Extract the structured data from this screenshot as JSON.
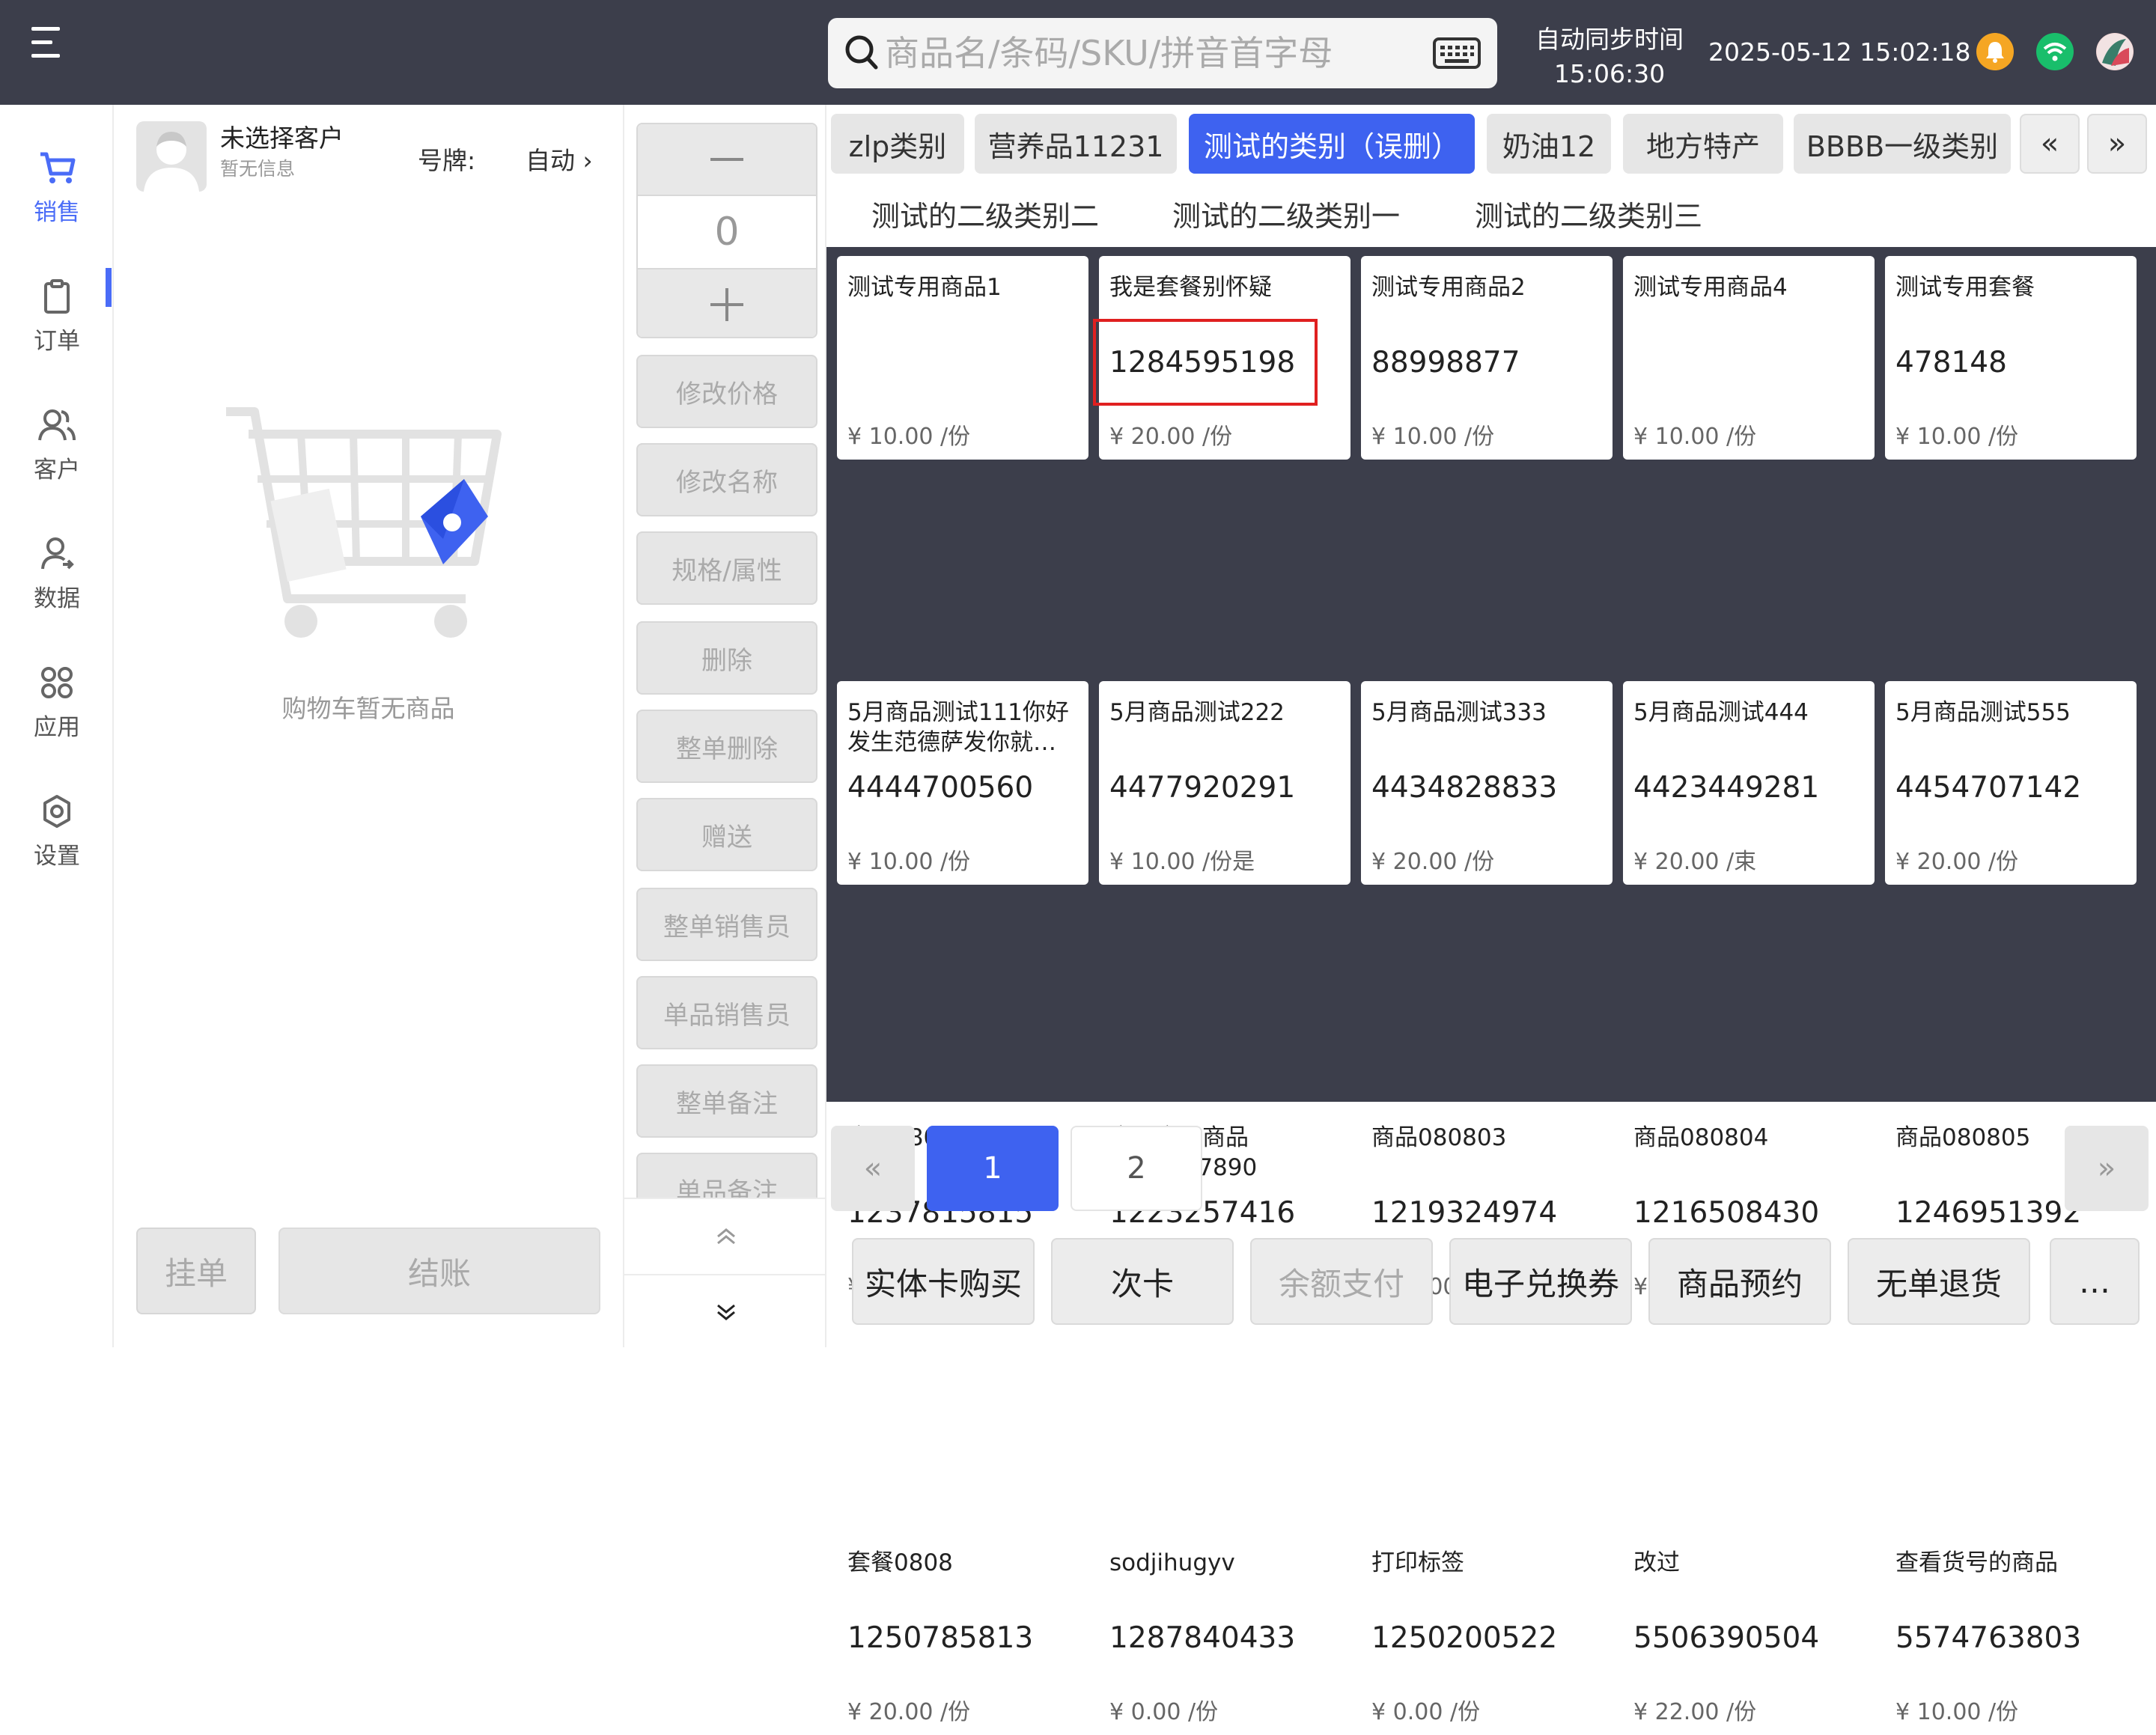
{
  "topbar": {
    "search_placeholder": "商品名/条码/SKU/拼音首字母",
    "sync_label": "自动同步时间",
    "sync_time": "15:06:30",
    "clock": "2025-05-12 15:02:18"
  },
  "sidebar": {
    "items": [
      {
        "label": "销售",
        "icon": "cart-icon"
      },
      {
        "label": "订单",
        "icon": "clipboard-icon"
      },
      {
        "label": "客户",
        "icon": "users-icon"
      },
      {
        "label": "数据",
        "icon": "user-data-icon"
      },
      {
        "label": "应用",
        "icon": "apps-icon"
      },
      {
        "label": "设置",
        "icon": "gear-icon"
      }
    ]
  },
  "cart": {
    "customer_name": "未选择客户",
    "customer_info": "暂无信息",
    "plate_label": "号牌:",
    "plate_value": "自动 ›",
    "empty_text": "购物车暂无商品",
    "hold_label": "挂单",
    "checkout_label": "结账"
  },
  "actions": {
    "qty_value": "0",
    "buttons": [
      "修改价格",
      "修改名称",
      "规格/属性",
      "删除",
      "整单删除",
      "赠送",
      "整单销售员",
      "单品销售员",
      "整单备注",
      "单品备注"
    ]
  },
  "categories": {
    "tabs": [
      "zlp类别",
      "营养品11231",
      "测试的类别（误删）",
      "奶油12",
      "地方特产",
      "BBBB一级类别"
    ],
    "active_index": 2,
    "prev": "«",
    "next": "»",
    "subcategories": [
      "测试的二级类别二",
      "测试的二级类别一",
      "测试的二级类别三"
    ]
  },
  "products": [
    {
      "name": "测试专用商品1",
      "code": "",
      "price": "¥ 10.00 /份"
    },
    {
      "name": "我是套餐别怀疑",
      "code": "1284595198",
      "price": "¥ 20.00 /份"
    },
    {
      "name": "测试专用商品2",
      "code": "88998877",
      "price": "¥ 10.00 /份"
    },
    {
      "name": "测试专用商品4",
      "code": "",
      "price": "¥ 10.00 /份"
    },
    {
      "name": "测试专用套餐",
      "code": "478148",
      "price": "¥ 10.00 /份"
    },
    {
      "name": "5月商品测试111你好发生范德萨发你就…",
      "code": "4444700560",
      "price": "¥ 10.00 /份"
    },
    {
      "name": "5月商品测试222",
      "code": "4477920291",
      "price": "¥ 10.00 /份是"
    },
    {
      "name": "5月商品测试333",
      "code": "4434828833",
      "price": "¥ 20.00 /份"
    },
    {
      "name": "5月商品测试444",
      "code": "4423449281",
      "price": "¥ 20.00 /束"
    },
    {
      "name": "5月商品测试555",
      "code": "4454707142",
      "price": "¥ 20.00 /份"
    },
    {
      "name": "商品080801",
      "code": "1237815815",
      "price": "¥ 10.00 /份"
    },
    {
      "name": "商品商品商品1234567890",
      "code": "1223257416",
      "price": "¥ 10.00 /份"
    },
    {
      "name": "商品080803",
      "code": "1219324974",
      "price": "¥ 10.00 /份"
    },
    {
      "name": "商品080804",
      "code": "1216508430",
      "price": "¥ 10.00 /份"
    },
    {
      "name": "商品080805",
      "code": "1246951392",
      "price": "¥ 10.00 /份"
    },
    {
      "name": "套餐0808",
      "code": "1250785813",
      "price": "¥ 20.00 /份"
    },
    {
      "name": "sodjihugyv",
      "code": "1287840433",
      "price": "¥ 0.00 /份"
    },
    {
      "name": "打印标签",
      "code": "1250200522",
      "price": "¥ 0.00 /份"
    },
    {
      "name": "改过",
      "code": "5506390504",
      "price": "¥ 22.00 /份"
    },
    {
      "name": "查看货号的商品",
      "code": "5574763803",
      "price": "¥ 10.00 /份"
    }
  ],
  "pagination": {
    "prev": "«",
    "pages": [
      "1",
      "2"
    ],
    "current": "1",
    "next": "»"
  },
  "bottom": {
    "buttons": [
      "实体卡购买",
      "次卡",
      "余额支付",
      "电子兑换券",
      "商品预约",
      "无单退货",
      "…"
    ]
  },
  "colors": {
    "accent": "#3e62f0",
    "topbar": "#3c3e4b",
    "highlight": "#e02020",
    "bell": "#f5a623",
    "wifi": "#19be6b"
  }
}
